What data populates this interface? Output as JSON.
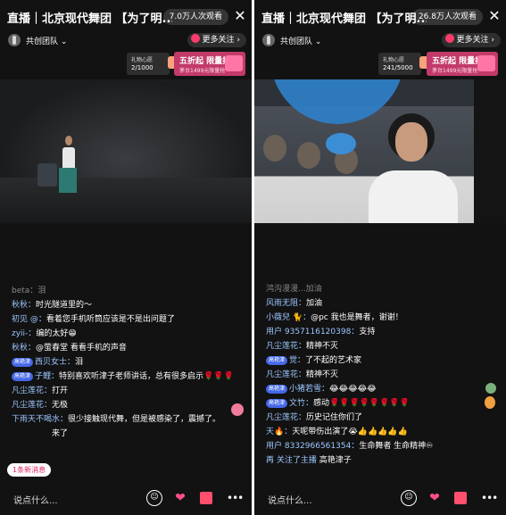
{
  "left": {
    "title": "直播｜北京现代舞团 【为了明...",
    "viewers": "7.0万人次观看",
    "close_icon": "close-icon",
    "team": "共创团队",
    "more_follow": "更多关注",
    "wish_label": "礼物心愿",
    "wish_progress": "2/1000",
    "promo_big": "五折起 限量抢!",
    "promo_small": "茅台1499元限量抢",
    "chat": [
      {
        "user": "beta：",
        "text": "泪",
        "faded": true
      },
      {
        "user": "秋秋：",
        "text": "时光隧道里的～"
      },
      {
        "user": "初见 @：",
        "text": "看着您手机听筒应该是不是出问题了"
      },
      {
        "user": "zyii-：",
        "text": "编的太好😁"
      },
      {
        "user": "秋秋：",
        "text": "@萤春堂 看看手机的声音"
      },
      {
        "badge": "高艳津",
        "user": "西贝女士：",
        "text": "泪"
      },
      {
        "badge": "高艳津",
        "user": "子鲤：",
        "text": "特别喜欢听津子老师讲话，总有很多启示🌹🌹🌹"
      },
      {
        "user": "凡尘莲花：",
        "text": "打开"
      },
      {
        "user": "凡尘莲花：",
        "text": "无极"
      },
      {
        "user": "下雨天不喝水：",
        "text": "很少接触现代舞，但是被感染了，震撼了。"
      },
      {
        "user": "",
        "text": "来了"
      }
    ],
    "new_messages": "1条新消息",
    "say_placeholder": "说点什么..."
  },
  "right": {
    "title": "直播｜北京现代舞团 【为了明...",
    "viewers": "26.8万人次观看",
    "team": "共创团队",
    "more_follow": "更多关注",
    "wish_label": "礼物心愿",
    "wish_progress": "241/5000",
    "promo_big": "五折起 限量抢!",
    "promo_small": "茅台1499元限量抢",
    "chat": [
      {
        "user": "",
        "text": "鸿沟漫漫...加油",
        "dim": true
      },
      {
        "user": "风雨无阻：",
        "text": "加油"
      },
      {
        "user": "小薇兒 🐈：",
        "text": "@pc 我也是舞者，谢谢！"
      },
      {
        "user": "用户 9357116120398：",
        "text": "支持"
      },
      {
        "user": "凡尘莲花：",
        "text": "精神不灭"
      },
      {
        "badge": "高艳津",
        "user": "觉：",
        "text": "了不起的艺术家"
      },
      {
        "user": "凡尘莲花：",
        "text": "精神不灭"
      },
      {
        "badge": "高艳津",
        "user": "小猪若雪：",
        "text": "😂😂😂😂😂"
      },
      {
        "badge": "高艳津",
        "user": "文竹：",
        "text": "感动🌹🌹🌹🌹🌹🌹🌹🌹"
      },
      {
        "user": "凡尘莲花：",
        "text": "历史记住你们了"
      },
      {
        "user": "天🔥：",
        "text": "天呢带伤出演了😭👍👍👍👍👍"
      },
      {
        "user": "用户 8332966561354：",
        "text": "生命舞者 生命精神♾"
      },
      {
        "user": "再 关注了主播",
        "text": "高艳津子"
      }
    ],
    "say_placeholder": "说点什么..."
  },
  "icons": {
    "emoji": "☺",
    "heart": "❤",
    "more": "•••"
  }
}
